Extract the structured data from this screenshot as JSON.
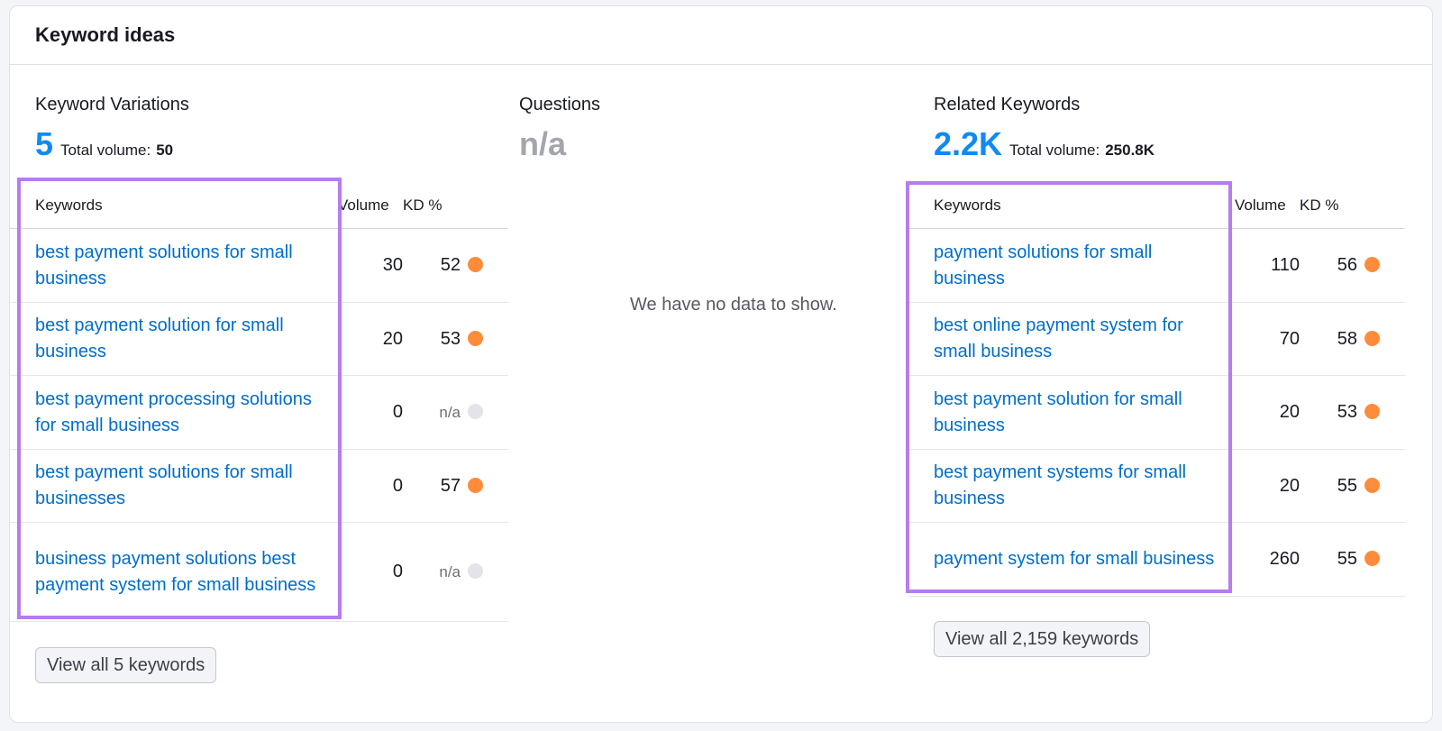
{
  "header": {
    "title": "Keyword ideas"
  },
  "colors": {
    "accent": "#0f8af5",
    "link": "#006dca",
    "kd_orange": "#ff8c3a",
    "kd_na": "#e3e4ea",
    "highlight": "#b67cf0"
  },
  "variations": {
    "title": "Keyword Variations",
    "count": "5",
    "volume_label": "Total volume:",
    "volume_value": "50",
    "columns": {
      "keywords": "Keywords",
      "volume": "Volume",
      "kd": "KD %"
    },
    "rows": [
      {
        "keyword": "best payment solutions for small business",
        "volume": "30",
        "kd": "52",
        "kd_level": "orange"
      },
      {
        "keyword": "best payment solution for small business",
        "volume": "20",
        "kd": "53",
        "kd_level": "orange"
      },
      {
        "keyword": "best payment processing solutions for small business",
        "volume": "0",
        "kd": "n/a",
        "kd_level": "na"
      },
      {
        "keyword": "best payment solutions for small businesses",
        "volume": "0",
        "kd": "57",
        "kd_level": "orange"
      },
      {
        "keyword": "business payment solutions best payment system for small business",
        "volume": "0",
        "kd": "n/a",
        "kd_level": "na"
      }
    ],
    "view_all": "View all 5 keywords"
  },
  "questions": {
    "title": "Questions",
    "count": "n/a",
    "empty_message": "We have no data to show."
  },
  "related": {
    "title": "Related Keywords",
    "count": "2.2K",
    "volume_label": "Total volume:",
    "volume_value": "250.8K",
    "columns": {
      "keywords": "Keywords",
      "volume": "Volume",
      "kd": "KD %"
    },
    "rows": [
      {
        "keyword": "payment solutions for small business",
        "volume": "110",
        "kd": "56",
        "kd_level": "orange"
      },
      {
        "keyword": "best online payment system for small business",
        "volume": "70",
        "kd": "58",
        "kd_level": "orange"
      },
      {
        "keyword": "best payment solution for small business",
        "volume": "20",
        "kd": "53",
        "kd_level": "orange"
      },
      {
        "keyword": "best payment systems for small business",
        "volume": "20",
        "kd": "55",
        "kd_level": "orange"
      },
      {
        "keyword": "payment system for small business",
        "volume": "260",
        "kd": "55",
        "kd_level": "orange"
      }
    ],
    "view_all": "View all 2,159 keywords"
  }
}
